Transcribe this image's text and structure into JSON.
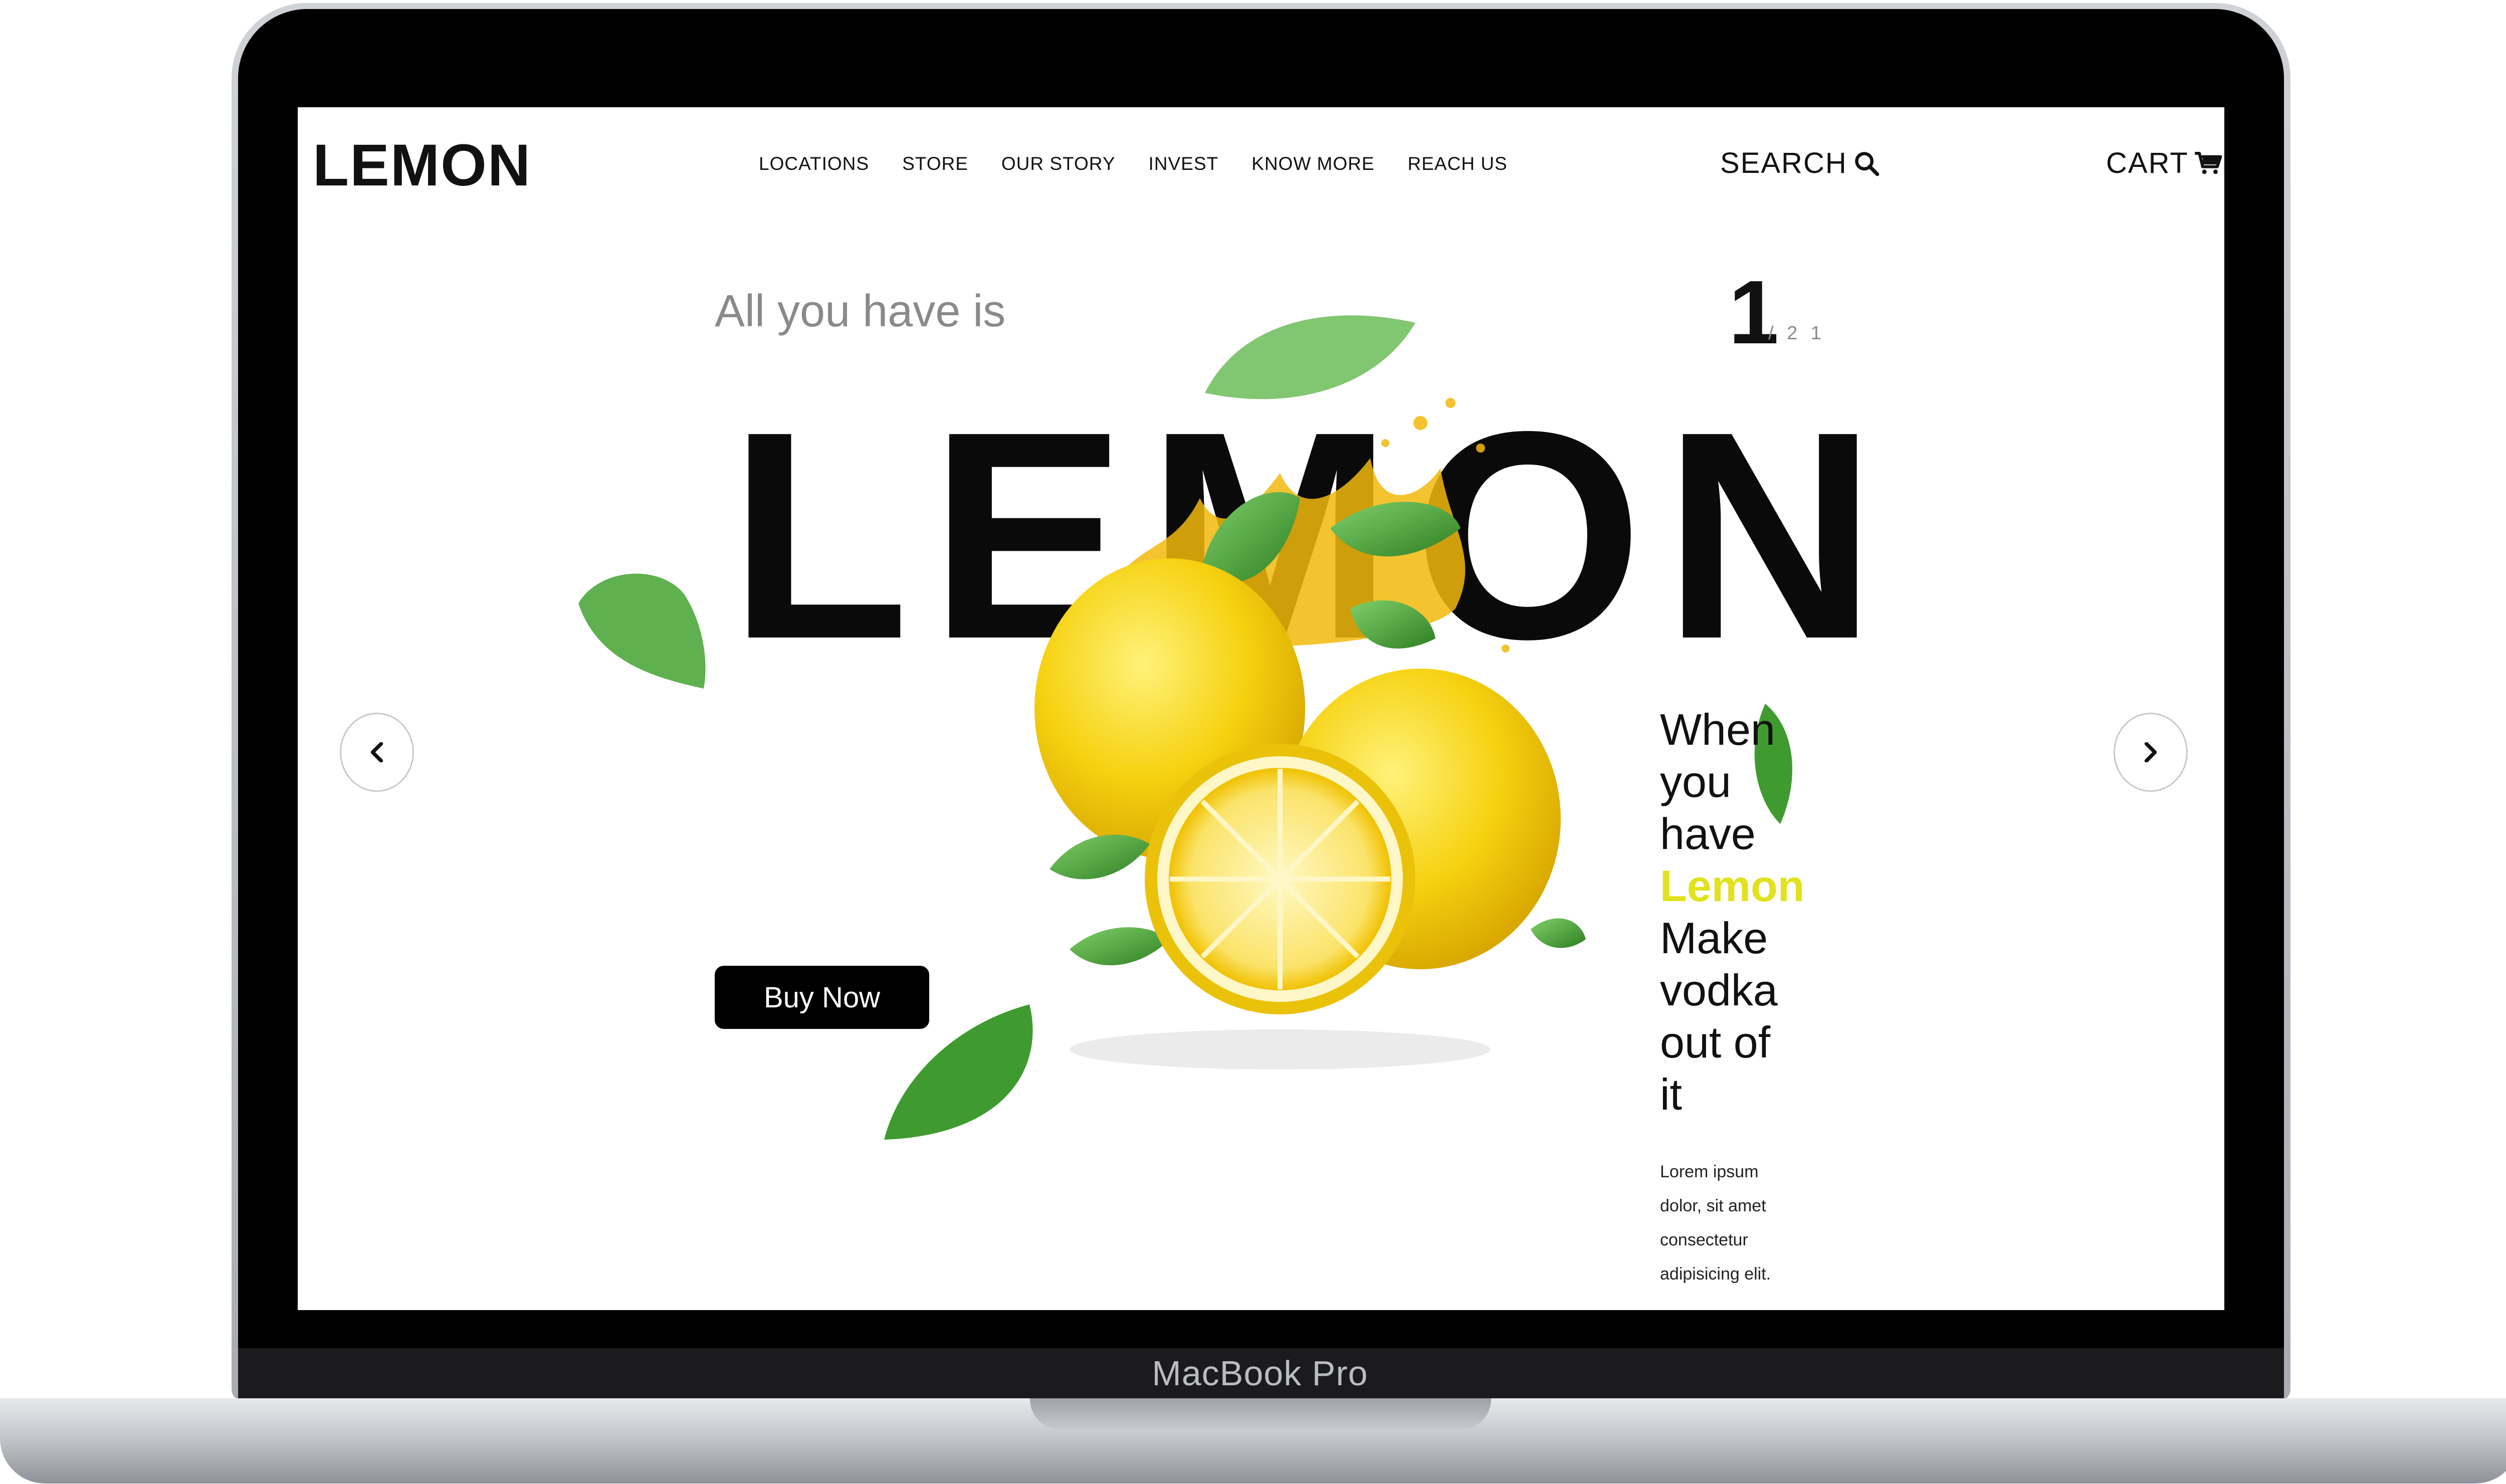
{
  "device": {
    "label": "MacBook Pro"
  },
  "header": {
    "brand": "LEMON",
    "nav": [
      "LOCATIONS",
      "STORE",
      "OUR STORY",
      "INVEST",
      "KNOW MORE",
      "REACH US"
    ],
    "search_label": "SEARCH",
    "cart_label": "CART"
  },
  "hero": {
    "tagline": "All you have is",
    "title": "LEMON",
    "slide_current": "1",
    "slide_total": "/ 2 1",
    "buy_label": "Buy Now",
    "quote_lines": [
      "When",
      "you",
      "have"
    ],
    "quote_accent": "Lemon",
    "quote_lines_after": [
      "Make",
      "vodka",
      "out of",
      "it"
    ],
    "lorem_lines": [
      "Lorem ipsum",
      "dolor, sit amet",
      "consectetur",
      "adipisicing elit."
    ]
  },
  "icons": {
    "search": "search-icon",
    "cart": "cart-icon",
    "prev": "chevron-left-icon",
    "next": "chevron-right-icon"
  },
  "colors": {
    "accent": "#e1e21d",
    "text": "#111111",
    "muted": "#8a8a8a",
    "lemon": "#f7d117",
    "leaf": "#3f9b2f"
  }
}
